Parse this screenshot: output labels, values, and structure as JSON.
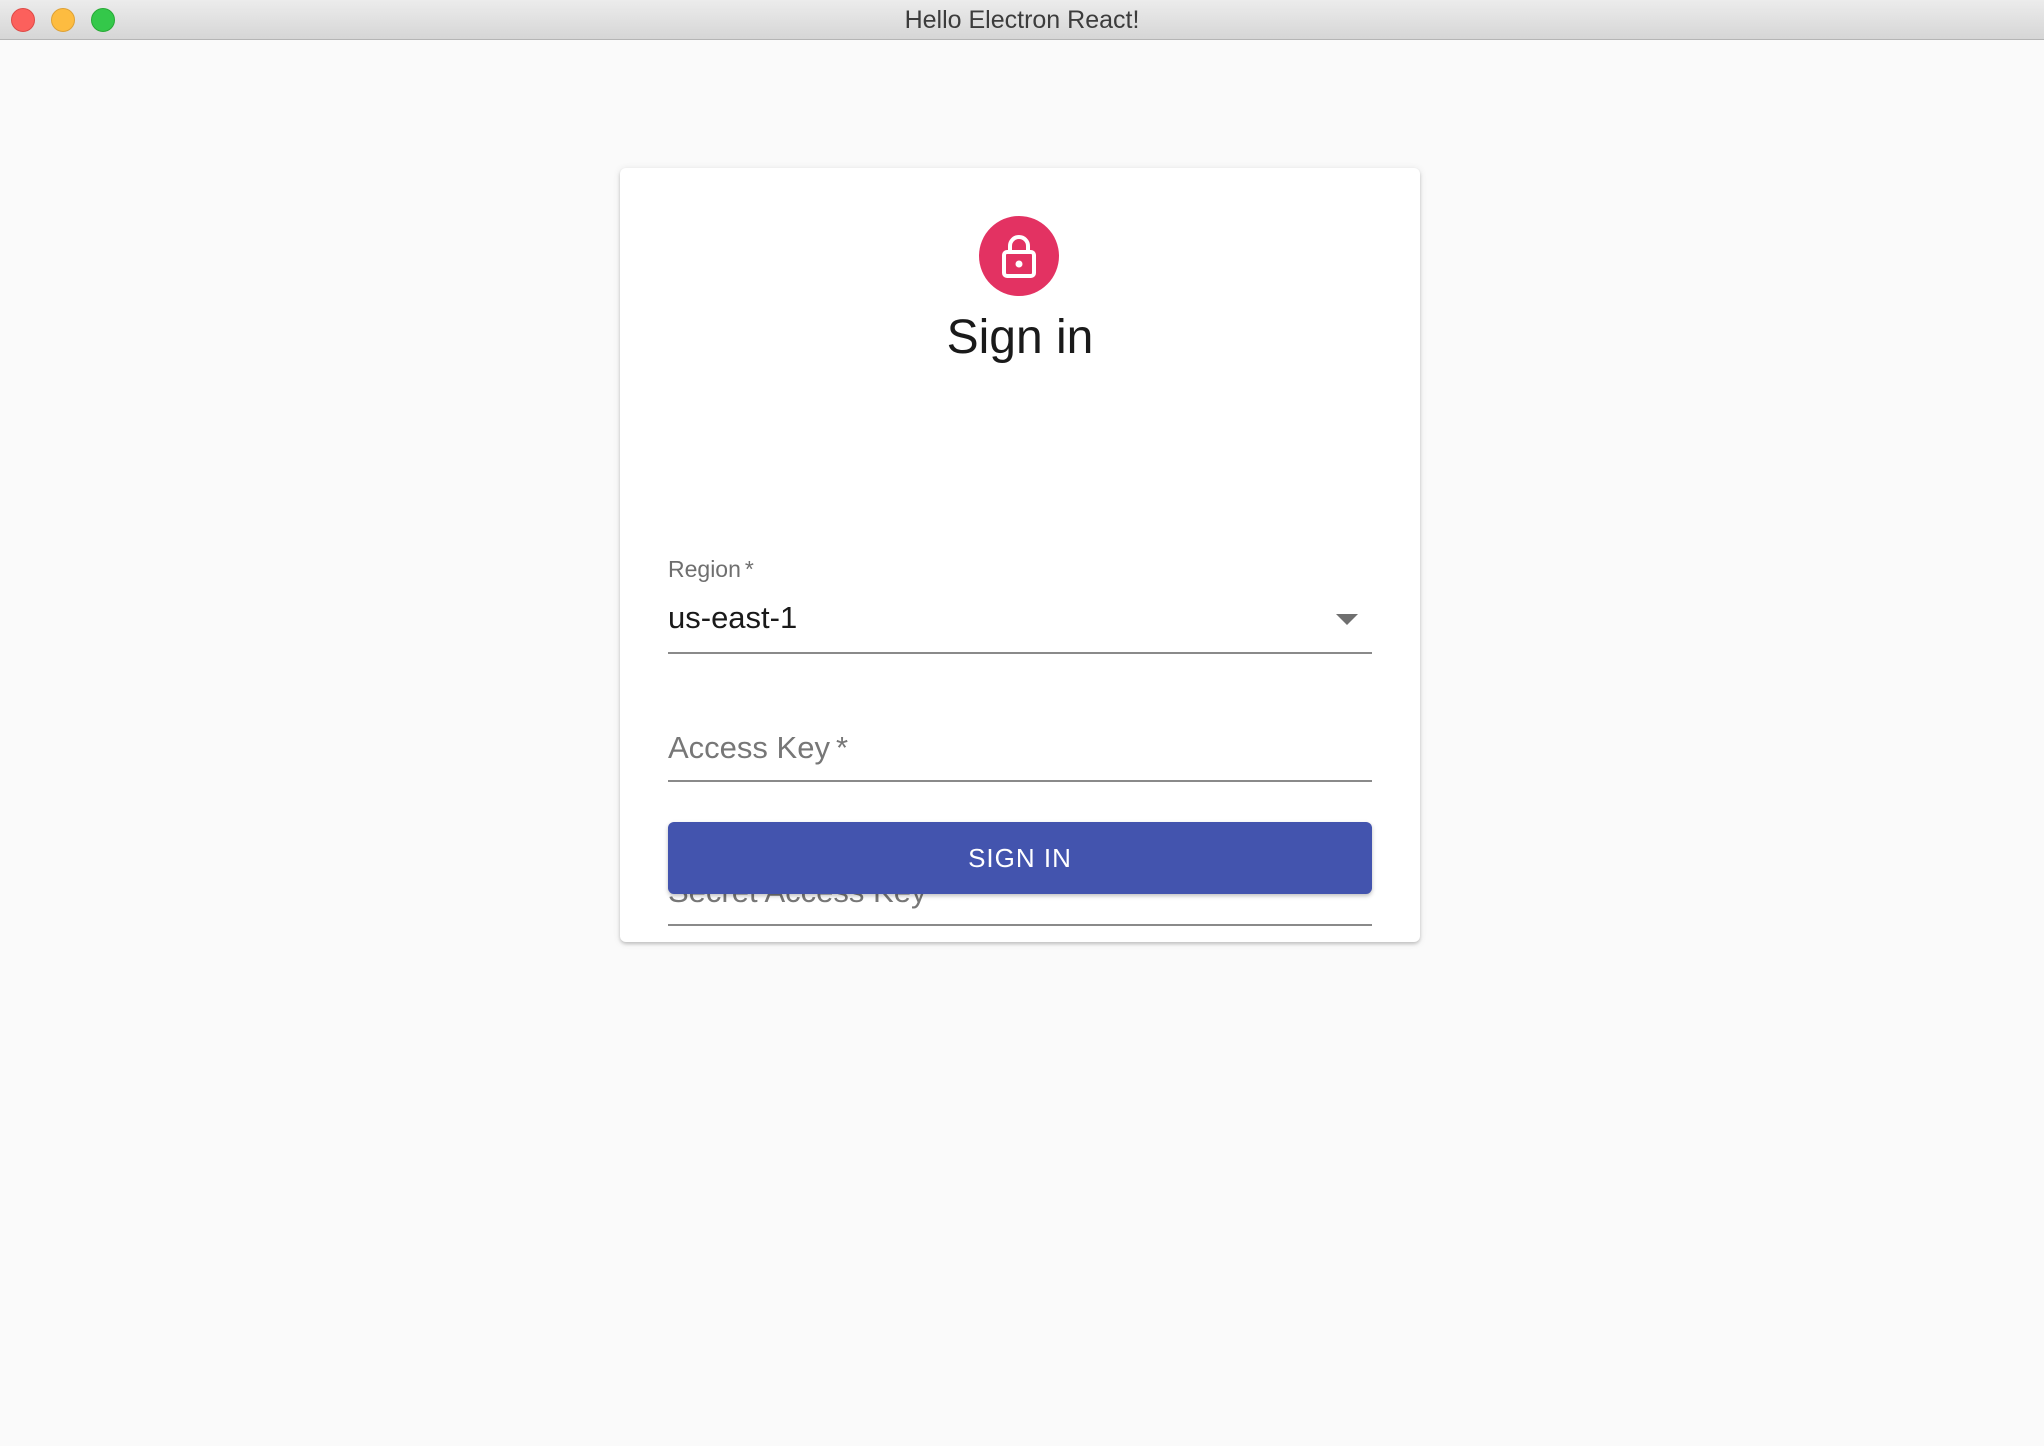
{
  "window": {
    "title": "Hello Electron React!",
    "controls": [
      "close",
      "minimize",
      "zoom"
    ]
  },
  "colors": {
    "background": "#fafafa",
    "avatar": "#e33262",
    "primary_button": "#4354ae",
    "button_text": "#ffffff"
  },
  "form": {
    "icon": "lock-icon",
    "heading": "Sign in",
    "region": {
      "label": "Region",
      "required_mark": "*",
      "value": "us-east-1"
    },
    "access_key": {
      "label": "Access Key",
      "required_mark": "*",
      "value": ""
    },
    "secret_access_key": {
      "label": "Secret Access Key",
      "required_mark": "*",
      "value": ""
    },
    "submit_label": "SIGN IN"
  }
}
